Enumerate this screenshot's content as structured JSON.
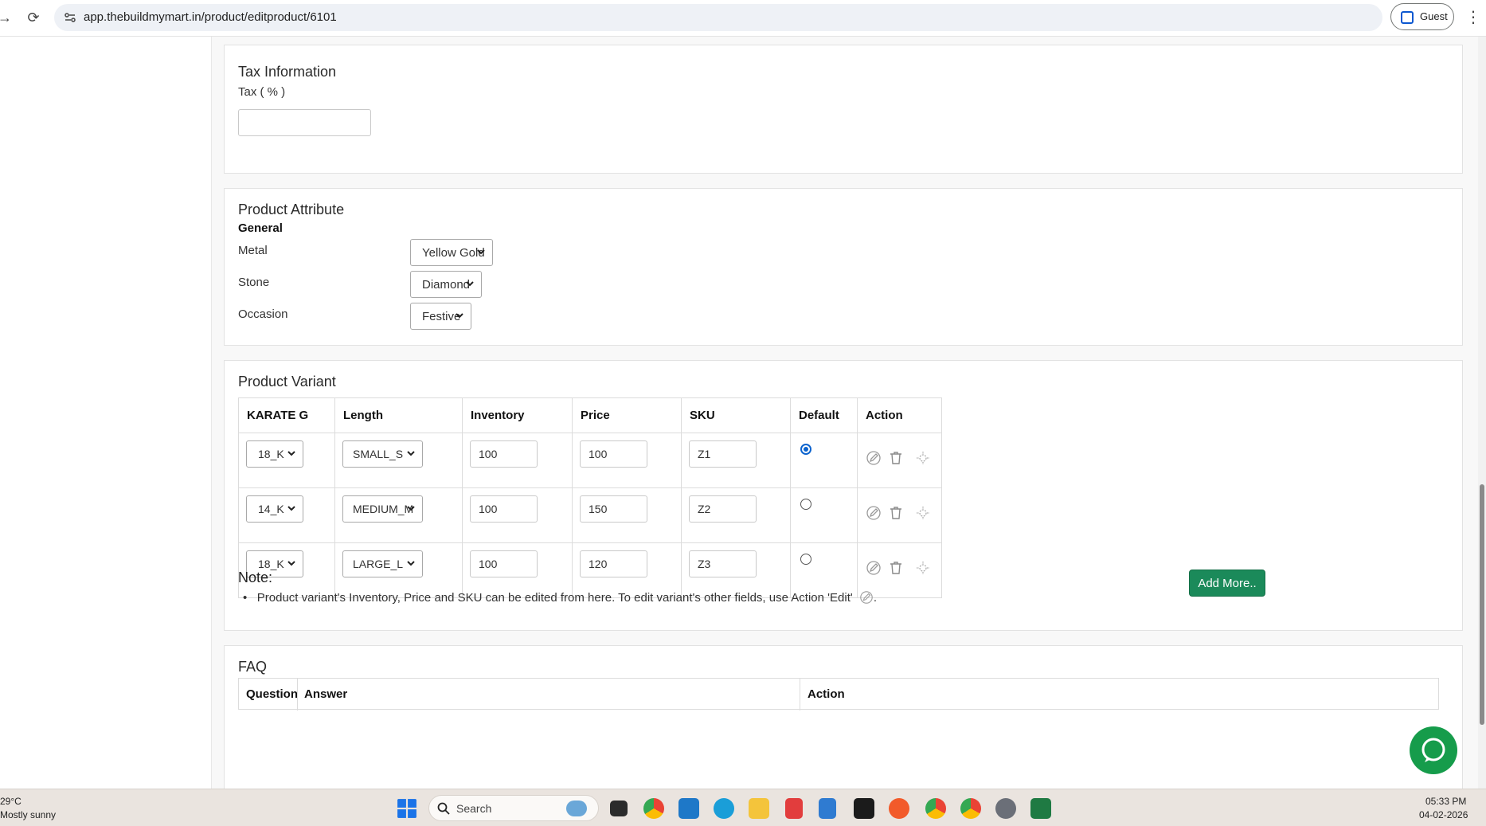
{
  "browser": {
    "url": "app.thebuildmymart.in/product/editproduct/6101",
    "profile_label": "Guest"
  },
  "tax": {
    "title": "Tax Information",
    "label": "Tax ( % )",
    "value": ""
  },
  "attributes": {
    "title": "Product Attribute",
    "group": "General",
    "fields": [
      {
        "label": "Metal",
        "value": "Yellow Gold"
      },
      {
        "label": "Stone",
        "value": "Diamond"
      },
      {
        "label": "Occasion",
        "value": "Festive"
      }
    ]
  },
  "variants": {
    "title": "Product Variant",
    "columns": [
      "KARATE G",
      "Length",
      "Inventory",
      "Price",
      "SKU",
      "Default",
      "Action"
    ],
    "rows": [
      {
        "karate": "18_K",
        "length": "SMALL_S",
        "inventory": "100",
        "price": "100",
        "sku": "Z1",
        "default": true
      },
      {
        "karate": "14_K",
        "length": "MEDIUM_M",
        "inventory": "100",
        "price": "150",
        "sku": "Z2",
        "default": false
      },
      {
        "karate": "18_K",
        "length": "LARGE_L",
        "inventory": "100",
        "price": "120",
        "sku": "Z3",
        "default": false
      }
    ],
    "note_title": "Note:",
    "note_text": "Product variant's Inventory, Price and SKU can be edited from here. To edit variant's other fields, use Action 'Edit'",
    "note_suffix": ".",
    "add_more_label": "Add More.."
  },
  "faq": {
    "title": "FAQ",
    "columns": [
      "Question",
      "Answer",
      "Action"
    ]
  },
  "taskbar": {
    "temperature": "29°C",
    "weather": "Mostly sunny",
    "search_label": "Search",
    "time": "05:33 PM",
    "date": "04-02-2026"
  },
  "colors": {
    "primary_button": "#1b8a5a",
    "chat_bubble": "#169c4b",
    "radio_selected": "#0b63ce"
  }
}
